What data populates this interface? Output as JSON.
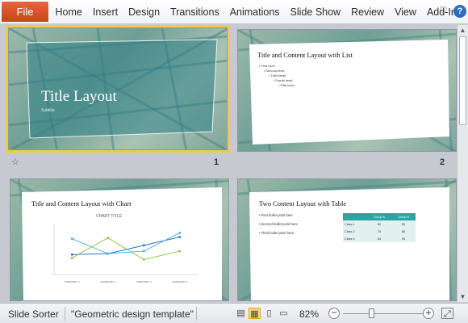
{
  "ribbon": {
    "file_label": "File",
    "tabs": [
      "Home",
      "Insert",
      "Design",
      "Transitions",
      "Animations",
      "Slide Show",
      "Review",
      "View",
      "Add-Ins"
    ],
    "help_label": "?"
  },
  "slides": [
    {
      "number": "1",
      "title": "Title Layout",
      "subtitle": "Subtitle"
    },
    {
      "number": "2",
      "title": "Title and Content Layout with List",
      "bullets": [
        "First level",
        "Second level",
        "Third level",
        "Fourth level",
        "Fifth level"
      ]
    },
    {
      "number": "3",
      "title": "Title and Content Layout with Chart",
      "chart_title": "CHART TITLE",
      "chart_categories": [
        "CATEGORY 1",
        "CATEGORY 2",
        "CATEGORY 3",
        "CATEGORY 4"
      ]
    },
    {
      "number": "4",
      "title": "Two Content Layout with Table",
      "bullets": [
        "First bullet point here",
        "Second bullet point here",
        "Third bullet point here"
      ],
      "table": {
        "headers": [
          "",
          "Group A",
          "Group B"
        ],
        "rows": [
          [
            "Class 1",
            "82",
            "95"
          ],
          [
            "Class 2",
            "76",
            "88"
          ],
          [
            "Class 3",
            "84",
            "90"
          ]
        ]
      }
    }
  ],
  "chart_data": {
    "type": "line",
    "categories": [
      "CATEGORY 1",
      "CATEGORY 2",
      "CATEGORY 3",
      "CATEGORY 4"
    ],
    "title": "CHART TITLE",
    "series": [
      {
        "values": [
          2.4,
          2.5,
          3.5,
          4.5
        ],
        "color": "#2c6fbf"
      },
      {
        "values": [
          4.3,
          2.5,
          2.8,
          5.0
        ],
        "color": "#4ab3d4"
      },
      {
        "values": [
          2.0,
          4.4,
          1.8,
          2.8
        ],
        "color": "#8cc63f"
      }
    ],
    "ylim": [
      0,
      6
    ]
  },
  "status": {
    "view_name": "Slide Sorter",
    "theme_name": "\"Geometric design template\"",
    "zoom_level": "82%",
    "zoom_fraction": 0.35,
    "zoom_minus": "−",
    "zoom_plus": "+"
  },
  "colors": {
    "selection": "#f2c94c",
    "file_tab": "#d04f24",
    "teal": "#2aa6a3"
  }
}
